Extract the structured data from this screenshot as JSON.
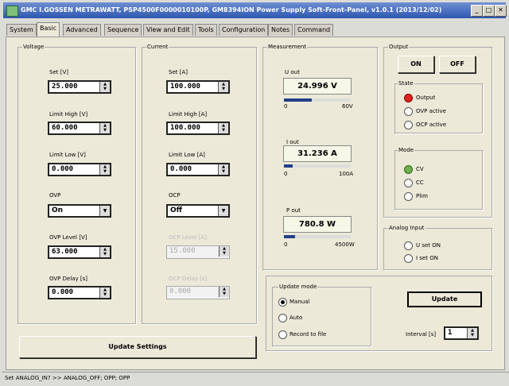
{
  "window": {
    "title": "GMC I.GOSSEN METRAWATT, PSP4500F0000010100P, GM8394ION Power Supply Soft-Front-Panel, v1.0.1 (2013/12/02)"
  },
  "tabs": [
    "System",
    "Basic",
    "Advanced",
    "Sequence",
    "View and Edit",
    "Tools",
    "Configuration",
    "Notes",
    "Command"
  ],
  "voltage": {
    "group_label": "Voltage",
    "set_label": "Set [V]",
    "set_value": "25.000",
    "limit_high_label": "Limit High [V]",
    "limit_high_value": "60.000",
    "limit_low_label": "Limit Low [V]",
    "limit_low_value": "0.000",
    "ovp_label": "OVP",
    "ovp_value": "On",
    "ovp_level_label": "OVP Level [V]",
    "ovp_level_value": "63.000",
    "ovp_delay_label": "OVP Delay [s]",
    "ovp_delay_value": "0.000"
  },
  "current": {
    "group_label": "Current",
    "set_label": "Set [A]",
    "set_value": "100.000",
    "limit_high_label": "Limit High [A]",
    "limit_high_value": "100.000",
    "limit_low_label": "Limit Low [A]",
    "limit_low_value": "0.000",
    "ocp_label": "OCP",
    "ocp_value": "Off",
    "ocp_level_label": "OCP Level [A]",
    "ocp_level_value": "15.000",
    "ocp_delay_label": "OCP Delay [s]",
    "ocp_delay_value": "0.000"
  },
  "measurement": {
    "group_label": "Measurement",
    "u_out_label": "U out",
    "u_out_value": "24.996 V",
    "u_out_min": "0",
    "u_out_max": "60V",
    "u_out_fraction": 0.42,
    "i_out_label": "I out",
    "i_out_value": "31.236 A",
    "i_out_min": "0",
    "i_out_max": "100A",
    "i_out_fraction": 0.13,
    "p_out_label": "P out",
    "p_out_value": "780.8 W",
    "p_out_min": "0",
    "p_out_max": "4500W",
    "p_out_fraction": 0.17
  },
  "output": {
    "group_label": "Output",
    "on_label": "ON",
    "off_label": "OFF",
    "state_label": "State",
    "state_items": [
      "Output",
      "OVP active",
      "OCP active"
    ],
    "mode_label": "Mode",
    "mode_items": [
      "CV",
      "CC",
      "Plim"
    ]
  },
  "analog_input": {
    "group_label": "Analog Input",
    "items": [
      "U set ON",
      "I set ON"
    ]
  },
  "update_mode": {
    "group_label": "Update mode",
    "options": [
      "Manual",
      "Auto",
      "Record to file"
    ],
    "update_button": "Update",
    "interval_label": "Interval [s]",
    "interval_value": "1"
  },
  "update_settings_button": "Update Settings",
  "status_bar": "Set ANALOG_IN? >> ANALOG_OFF; OPP; OPP",
  "colors": {
    "title_bar": "#2d56b0",
    "state_output": "#d22222",
    "mode_cv": "#6bb04a",
    "bar_fill": "#223f8a"
  }
}
